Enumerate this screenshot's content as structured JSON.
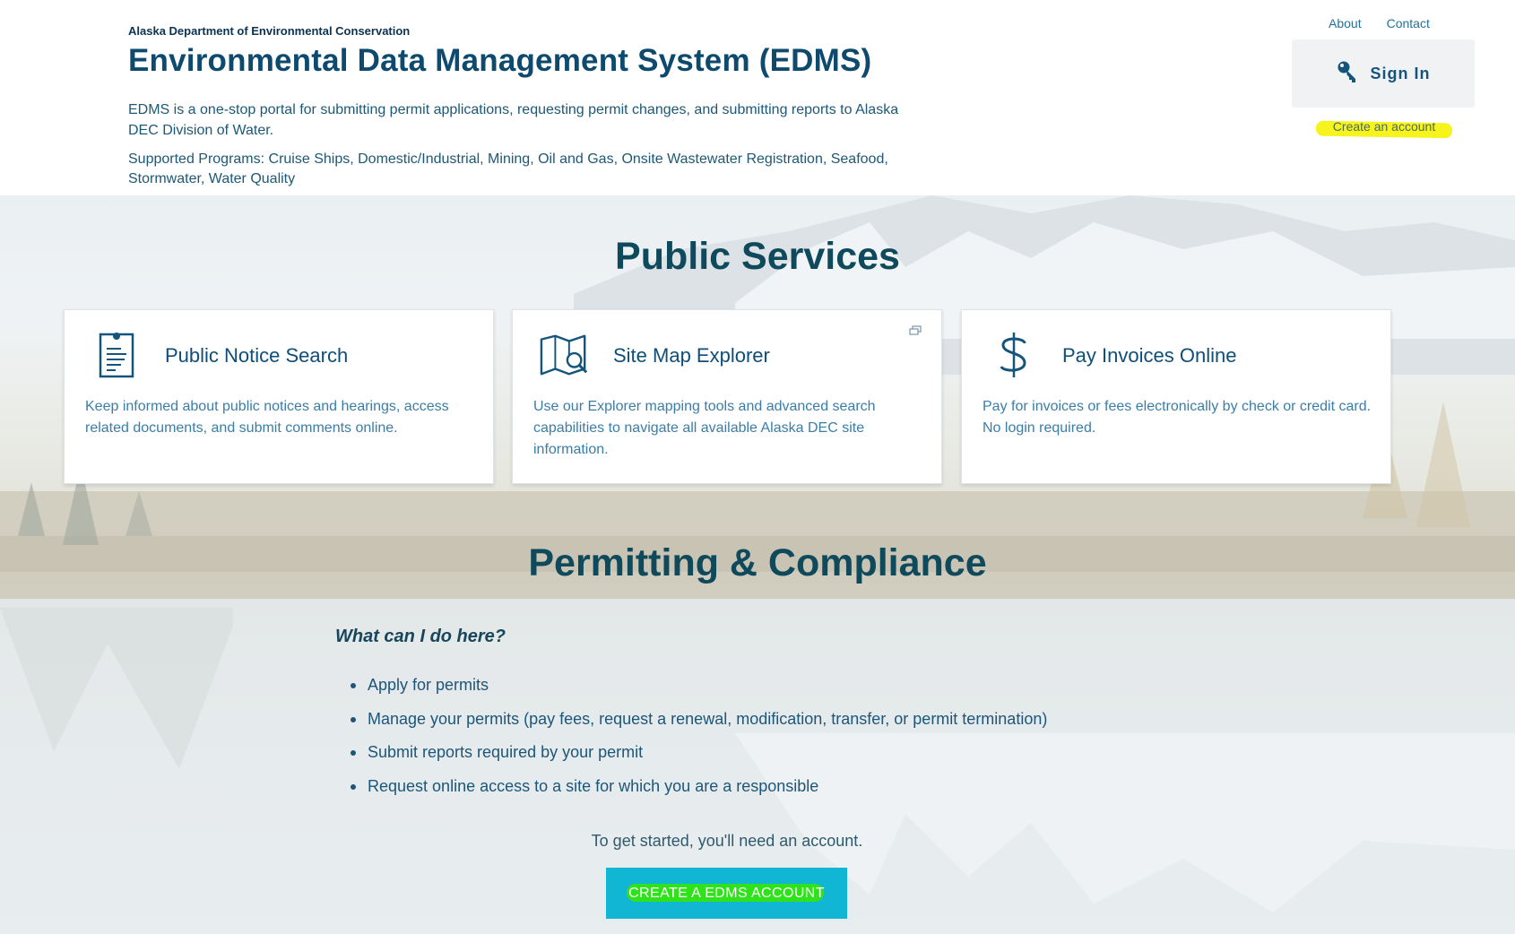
{
  "header": {
    "org": "Alaska Department of Environmental Conservation",
    "title": "Environmental Data Management System (EDMS)",
    "intro": "EDMS is a one-stop portal for submitting permit applications, requesting permit changes, and submitting reports to Alaska DEC Division of Water.",
    "programs": "Supported Programs: Cruise Ships, Domestic/Industrial, Mining, Oil and Gas, Onsite Wastewater Registration, Seafood, Stormwater, Water Quality"
  },
  "top_links": {
    "about": "About",
    "contact": "Contact"
  },
  "auth": {
    "sign_in_label": "Sign In",
    "sign_in_icon": "key-icon",
    "create_account_link": "Create an account"
  },
  "public_services": {
    "title": "Public Services",
    "cards": [
      {
        "icon": "document-list-icon",
        "title": "Public Notice Search",
        "description": "Keep informed about public notices and hearings, access related documents, and submit comments online."
      },
      {
        "icon": "map-search-icon",
        "title": "Site Map Explorer",
        "description": "Use our Explorer mapping tools and advanced search capabilities to navigate all available Alaska DEC site information.",
        "external_icon": "external-window-icon"
      },
      {
        "icon": "dollar-icon",
        "title": "Pay Invoices Online",
        "description": "Pay for invoices or fees electronically by check or credit card. No login required."
      }
    ]
  },
  "permitting": {
    "title": "Permitting & Compliance",
    "question": "What can I do here?",
    "items": [
      "Apply for permits",
      "Manage your permits (pay fees, request a renewal, modification, transfer, or permit termination)",
      "Submit reports required by your permit",
      "Request online access to a site for which you are a responsible"
    ],
    "get_started": "To get started, you'll need an account.",
    "cta_label": "CREATE A EDMS ACCOUNT"
  },
  "colors": {
    "primary": "#0d4a6e",
    "cta": "#11b6d4",
    "highlight_yellow": "#f6f41c",
    "highlight_green": "#2fe31b"
  }
}
